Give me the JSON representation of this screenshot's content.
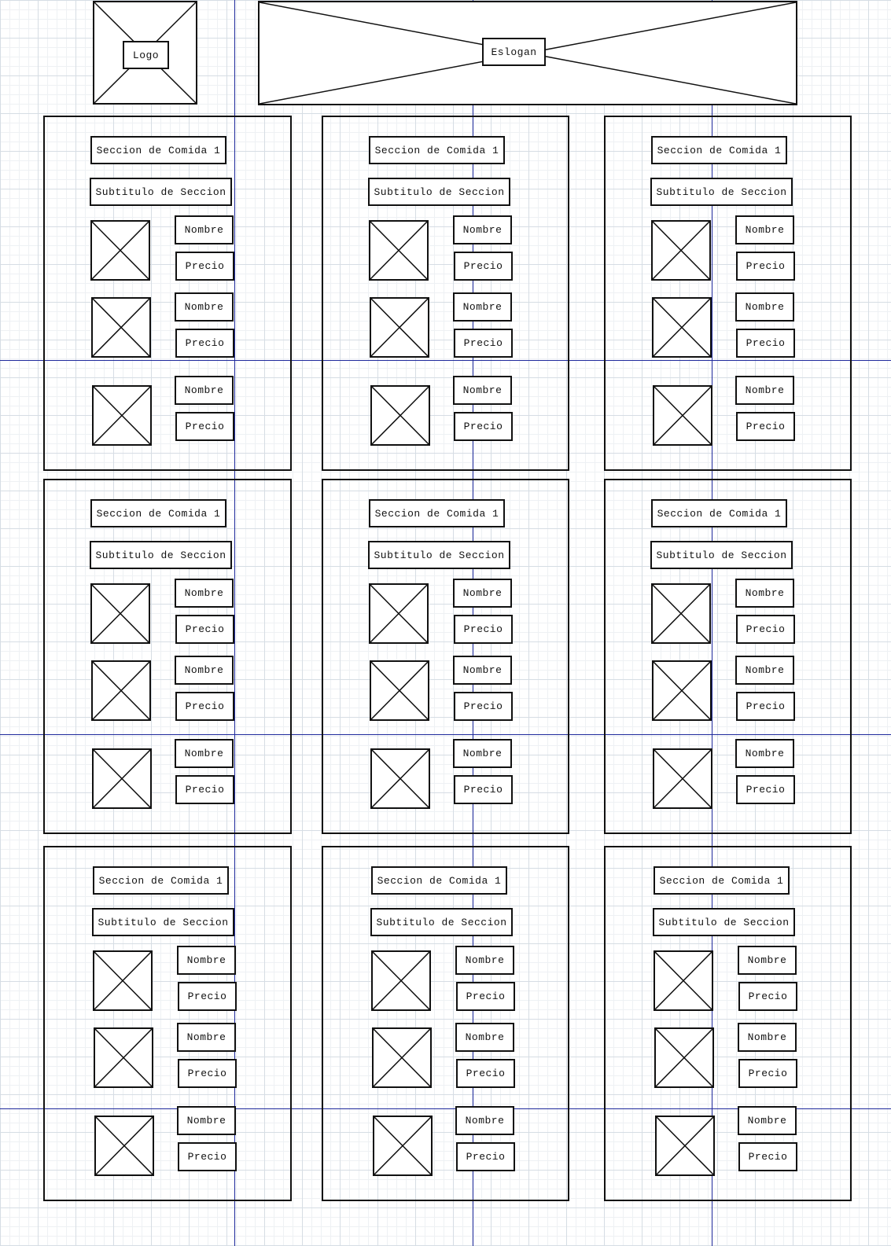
{
  "header": {
    "logo_label": "Logo",
    "slogan_label": "Eslogan"
  },
  "sections": [
    {
      "title": "Seccion de Comida 1",
      "subtitle": "Subtitulo de Seccion",
      "items": [
        {
          "name": "Nombre",
          "price": "Precio"
        },
        {
          "name": "Nombre",
          "price": "Precio"
        },
        {
          "name": "Nombre",
          "price": "Precio"
        }
      ]
    },
    {
      "title": "Seccion de Comida 1",
      "subtitle": "Subtitulo de Seccion",
      "items": [
        {
          "name": "Nombre",
          "price": "Precio"
        },
        {
          "name": "Nombre",
          "price": "Precio"
        },
        {
          "name": "Nombre",
          "price": "Precio"
        }
      ]
    },
    {
      "title": "Seccion de Comida 1",
      "subtitle": "Subtitulo de Seccion",
      "items": [
        {
          "name": "Nombre",
          "price": "Precio"
        },
        {
          "name": "Nombre",
          "price": "Precio"
        },
        {
          "name": "Nombre",
          "price": "Precio"
        }
      ]
    },
    {
      "title": "Seccion de Comida 1",
      "subtitle": "Subtitulo de Seccion",
      "items": [
        {
          "name": "Nombre",
          "price": "Precio"
        },
        {
          "name": "Nombre",
          "price": "Precio"
        },
        {
          "name": "Nombre",
          "price": "Precio"
        }
      ]
    },
    {
      "title": "Seccion de Comida 1",
      "subtitle": "Subtitulo de Seccion",
      "items": [
        {
          "name": "Nombre",
          "price": "Precio"
        },
        {
          "name": "Nombre",
          "price": "Precio"
        },
        {
          "name": "Nombre",
          "price": "Precio"
        }
      ]
    },
    {
      "title": "Seccion de Comida 1",
      "subtitle": "Subtitulo de Seccion",
      "items": [
        {
          "name": "Nombre",
          "price": "Precio"
        },
        {
          "name": "Nombre",
          "price": "Precio"
        },
        {
          "name": "Nombre",
          "price": "Precio"
        }
      ]
    },
    {
      "title": "Seccion de Comida 1",
      "subtitle": "Subtitulo de Seccion",
      "items": [
        {
          "name": "Nombre",
          "price": "Precio"
        },
        {
          "name": "Nombre",
          "price": "Precio"
        },
        {
          "name": "Nombre",
          "price": "Precio"
        }
      ]
    },
    {
      "title": "Seccion de Comida 1",
      "subtitle": "Subtitulo de Seccion",
      "items": [
        {
          "name": "Nombre",
          "price": "Precio"
        },
        {
          "name": "Nombre",
          "price": "Precio"
        },
        {
          "name": "Nombre",
          "price": "Precio"
        }
      ]
    },
    {
      "title": "Seccion de Comida 1",
      "subtitle": "Subtitulo de Seccion",
      "items": [
        {
          "name": "Nombre",
          "price": "Precio"
        },
        {
          "name": "Nombre",
          "price": "Precio"
        },
        {
          "name": "Nombre",
          "price": "Precio"
        }
      ]
    }
  ],
  "colors": {
    "stroke": "#111111",
    "guide": "#1f2a9c",
    "grid": "#d6dde4",
    "background": "#ffffff"
  }
}
